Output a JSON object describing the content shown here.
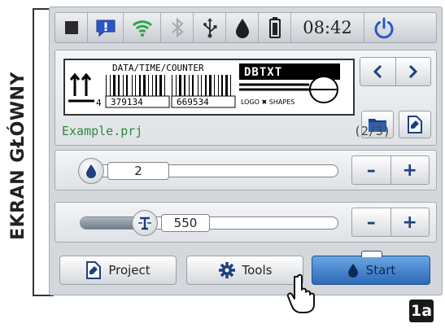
{
  "side_label": "EKRAN GŁÓWNY",
  "status_bar": {
    "icons": [
      "stop-square-icon",
      "alert-message-icon",
      "wifi-icon",
      "bluetooth-icon",
      "usb-icon",
      "ink-drop-icon",
      "battery-icon",
      "power-icon"
    ],
    "time": "08:42",
    "alert_color": "#2a56c6",
    "wifi_color": "#2aa84a"
  },
  "preview": {
    "label_header": "DATA/TIME/COUNTER",
    "logo_text": "DBTXT",
    "caption": "LOGO ✖ SHAPES",
    "digit": "4",
    "barcode_numbers": [
      "379134",
      "669534"
    ],
    "file_name": "Example.prj",
    "page_counter": "(2/3)"
  },
  "sliders": [
    {
      "icon": "ink-drop-icon",
      "value": "2",
      "fill": 0.08
    },
    {
      "icon": "text-size-icon",
      "value": "550",
      "fill": 0.27
    }
  ],
  "buttons": {
    "project": "Project",
    "tools": "Tools",
    "start": "Start"
  },
  "badge": "1a",
  "colors": {
    "accent": "#1e3f80",
    "start": "#3d7fd0",
    "file_name": "#2e8a3a"
  }
}
